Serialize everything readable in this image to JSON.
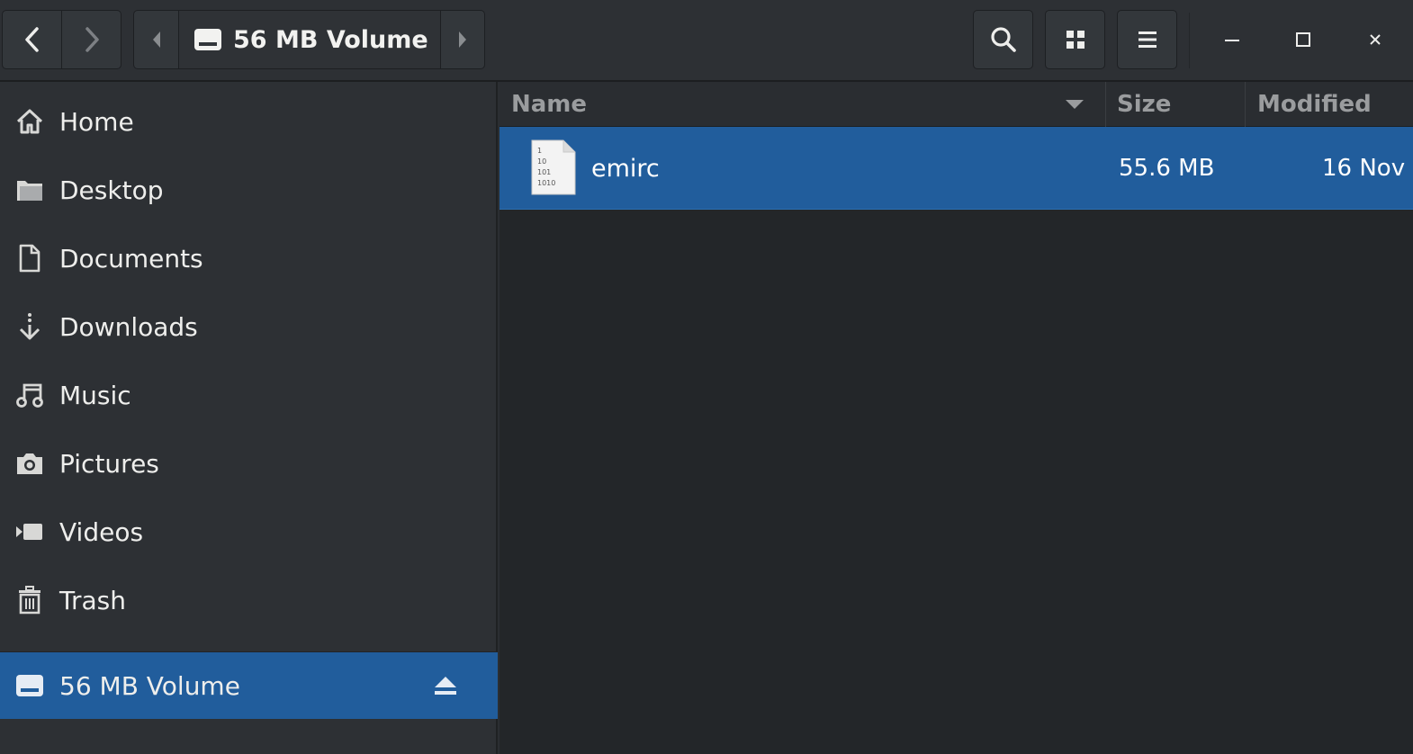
{
  "header": {
    "location_label": "56 MB Volume",
    "icons": {
      "back": "chevron-left-icon",
      "forward": "chevron-right-icon",
      "path_prev": "triangle-left-icon",
      "path_next": "triangle-right-icon",
      "drive": "drive-icon",
      "search": "search-icon",
      "view": "grid-view-icon",
      "menu": "hamburger-menu-icon",
      "minimize": "minimize-icon",
      "maximize": "maximize-icon",
      "close": "close-icon"
    }
  },
  "sidebar": {
    "items": [
      {
        "label": "Home",
        "icon": "home-icon"
      },
      {
        "label": "Desktop",
        "icon": "folder-icon"
      },
      {
        "label": "Documents",
        "icon": "document-icon"
      },
      {
        "label": "Downloads",
        "icon": "download-icon"
      },
      {
        "label": "Music",
        "icon": "music-icon"
      },
      {
        "label": "Pictures",
        "icon": "camera-icon"
      },
      {
        "label": "Videos",
        "icon": "video-icon"
      },
      {
        "label": "Trash",
        "icon": "trash-icon"
      }
    ],
    "devices": [
      {
        "label": "56 MB Volume",
        "icon": "drive-icon",
        "action_icon": "eject-icon",
        "selected": true
      }
    ]
  },
  "file_list": {
    "columns": {
      "name": "Name",
      "size": "Size",
      "modified": "Modified"
    },
    "rows": [
      {
        "name": "emirc",
        "size": "55.6 MB",
        "modified": "16 Nov",
        "icon": "binary-file-icon",
        "selected": true
      }
    ]
  },
  "colors": {
    "selection": "#215d9c",
    "sidebar_bg": "#2d3034",
    "main_bg": "#232629",
    "text": "#eeeeec"
  }
}
